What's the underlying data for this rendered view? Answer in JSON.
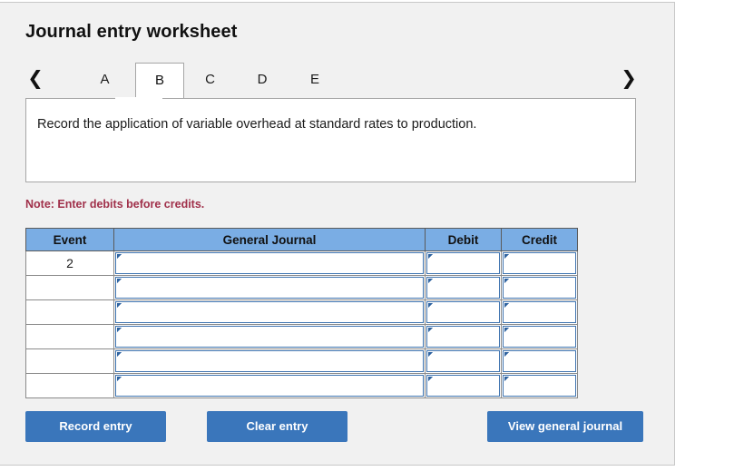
{
  "card": {
    "title": "Journal entry worksheet"
  },
  "tabs": {
    "prev_icon": "chevron-left-icon",
    "next_icon": "chevron-right-icon",
    "items": [
      {
        "label": "A",
        "active": false
      },
      {
        "label": "B",
        "active": true
      },
      {
        "label": "C",
        "active": false
      },
      {
        "label": "D",
        "active": false
      },
      {
        "label": "E",
        "active": false
      }
    ]
  },
  "requirement": {
    "text": "Record the application of variable overhead at standard rates to production."
  },
  "note": {
    "text": "Note: Enter debits before credits."
  },
  "table": {
    "headers": [
      "Event",
      "General Journal",
      "Debit",
      "Credit"
    ],
    "rows": [
      {
        "event": "2",
        "general_journal": "",
        "debit": "",
        "credit": ""
      },
      {
        "event": "",
        "general_journal": "",
        "debit": "",
        "credit": ""
      },
      {
        "event": "",
        "general_journal": "",
        "debit": "",
        "credit": ""
      },
      {
        "event": "",
        "general_journal": "",
        "debit": "",
        "credit": ""
      },
      {
        "event": "",
        "general_journal": "",
        "debit": "",
        "credit": ""
      },
      {
        "event": "",
        "general_journal": "",
        "debit": "",
        "credit": ""
      }
    ]
  },
  "buttons": {
    "record_entry": "Record entry",
    "clear_entry": "Clear entry",
    "view_general_journal": "View general journal"
  },
  "colors": {
    "page_background": "#ffffff",
    "card_background": "#f1f1f1",
    "table_header_blue": "#7aade4",
    "button_blue": "#3a76bb",
    "note_red": "#a0304a",
    "cell_border_blue": "#3f74b0"
  }
}
